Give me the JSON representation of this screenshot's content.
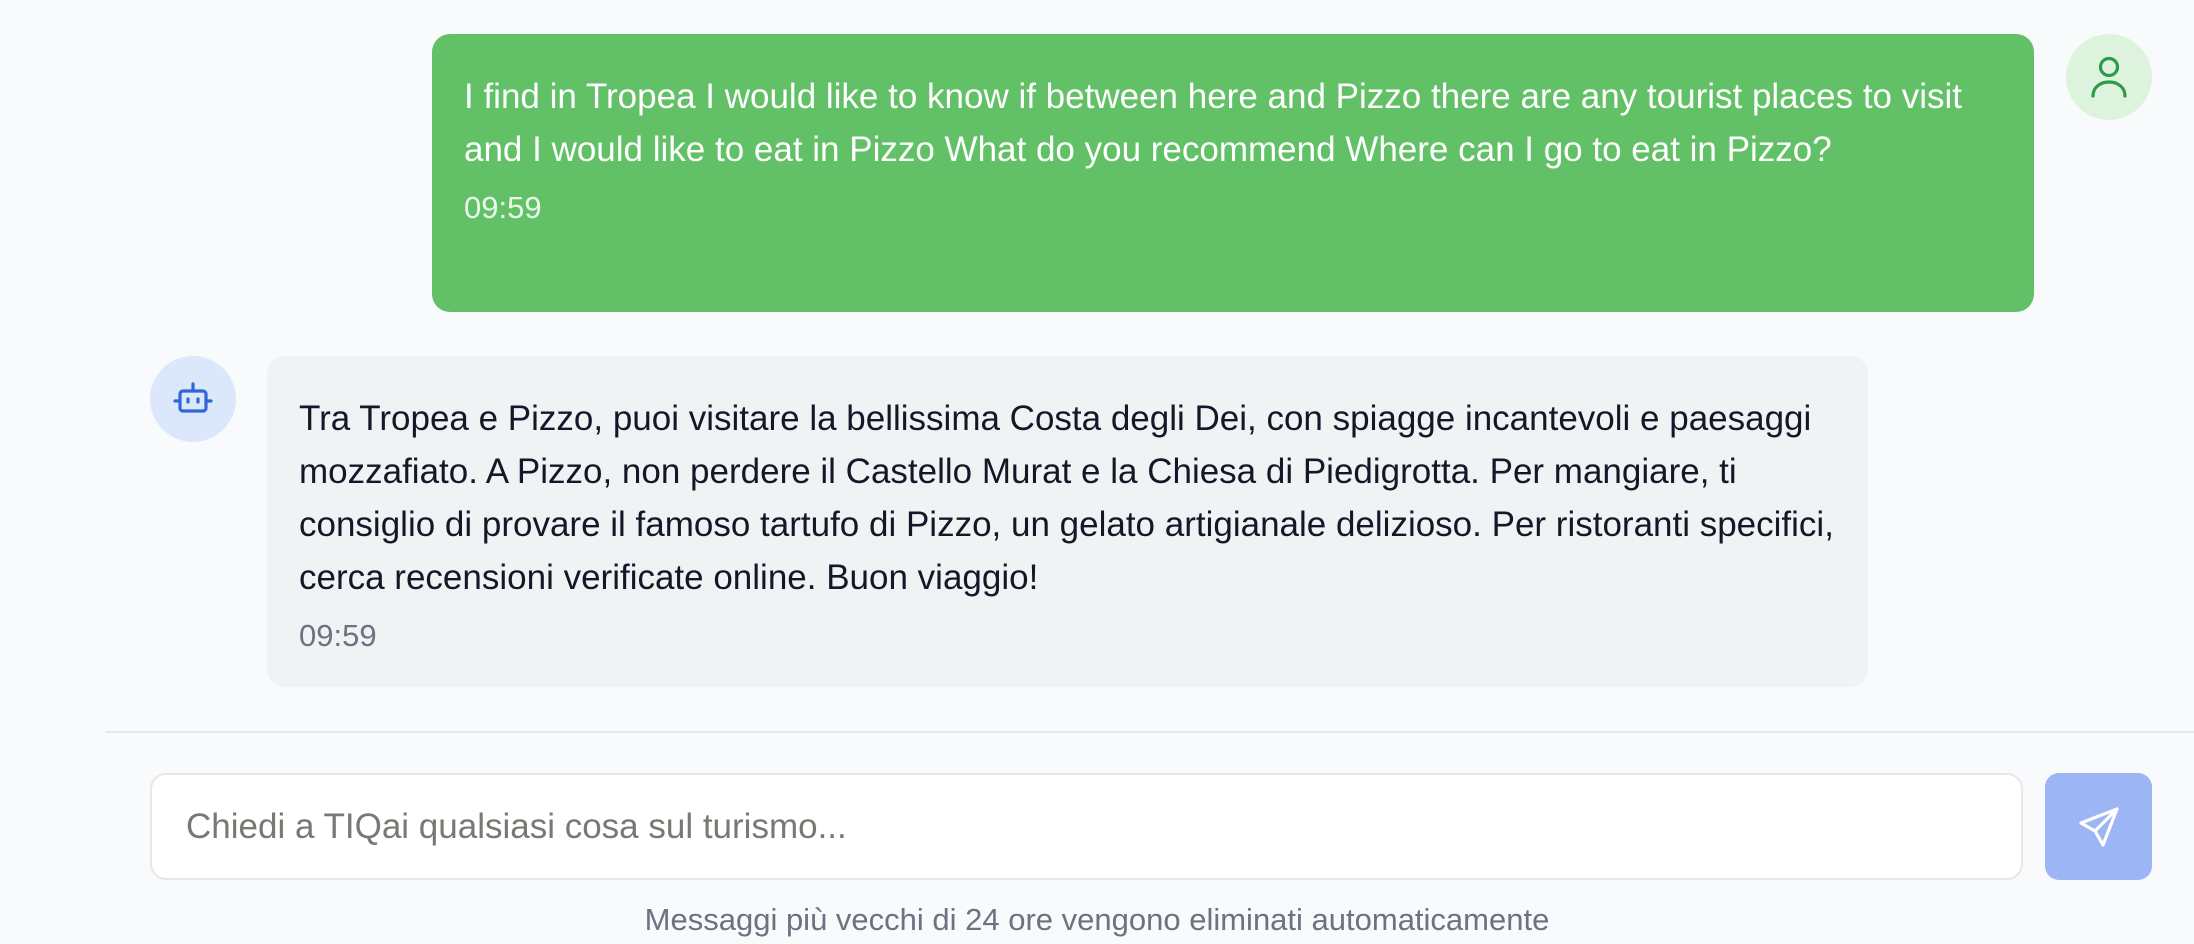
{
  "messages": {
    "user": {
      "text": "I find in Tropea I would like to know if between here and Pizzo there are any tourist places to visit and I would like to eat in Pizzo What do you recommend Where can I go to eat in Pizzo?",
      "time": "09:59",
      "avatar_icon": "user-icon"
    },
    "bot": {
      "text": "Tra Tropea e Pizzo, puoi visitare la bellissima Costa degli Dei, con spiagge incantevoli e paesaggi mozzafiato. A Pizzo, non perdere il Castello Murat e la Chiesa di Piedigrotta. Per mangiare, ti consiglio di provare il famoso tartufo di Pizzo, un gelato artigianale delizioso. Per ristoranti specifici, cerca recensioni verificate online. Buon viaggio!",
      "time": "09:59",
      "avatar_icon": "bot-icon"
    }
  },
  "composer": {
    "placeholder": "Chiedi a TIQai qualsiasi cosa sul turismo...",
    "value": "",
    "send_icon": "send-icon"
  },
  "footer": {
    "note": "Messaggi più vecchi di 24 ore vengono eliminati automaticamente"
  },
  "colors": {
    "user_bubble": "#62c167",
    "bot_bubble": "#f1f2f4",
    "user_avatar_bg": "#ddf3de",
    "bot_avatar_bg": "#dbe7fb",
    "send_button": "#9bb5f5",
    "bot_icon": "#2f67d6",
    "user_icon": "#2f9a47"
  }
}
